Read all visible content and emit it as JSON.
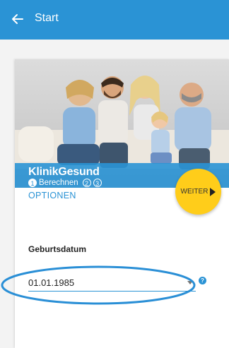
{
  "appbar": {
    "title": "Start",
    "back_icon": "arrow-left-icon",
    "color": "#2a93d5"
  },
  "hero": {
    "brand": "KlinikGesund"
  },
  "steps": [
    {
      "number": "1",
      "label": "Berechnen",
      "active": true
    },
    {
      "number": "2",
      "label": "",
      "active": false
    },
    {
      "number": "3",
      "label": "",
      "active": false
    }
  ],
  "weiter_button": {
    "label": "WEITER",
    "icon": "triangle-right-icon",
    "color": "#ffcd1a"
  },
  "section": {
    "title": "OPTIONEN"
  },
  "birthdate": {
    "label": "Geburtsdatum",
    "value": "01.01.1985",
    "help_icon": "help-circle-icon"
  }
}
